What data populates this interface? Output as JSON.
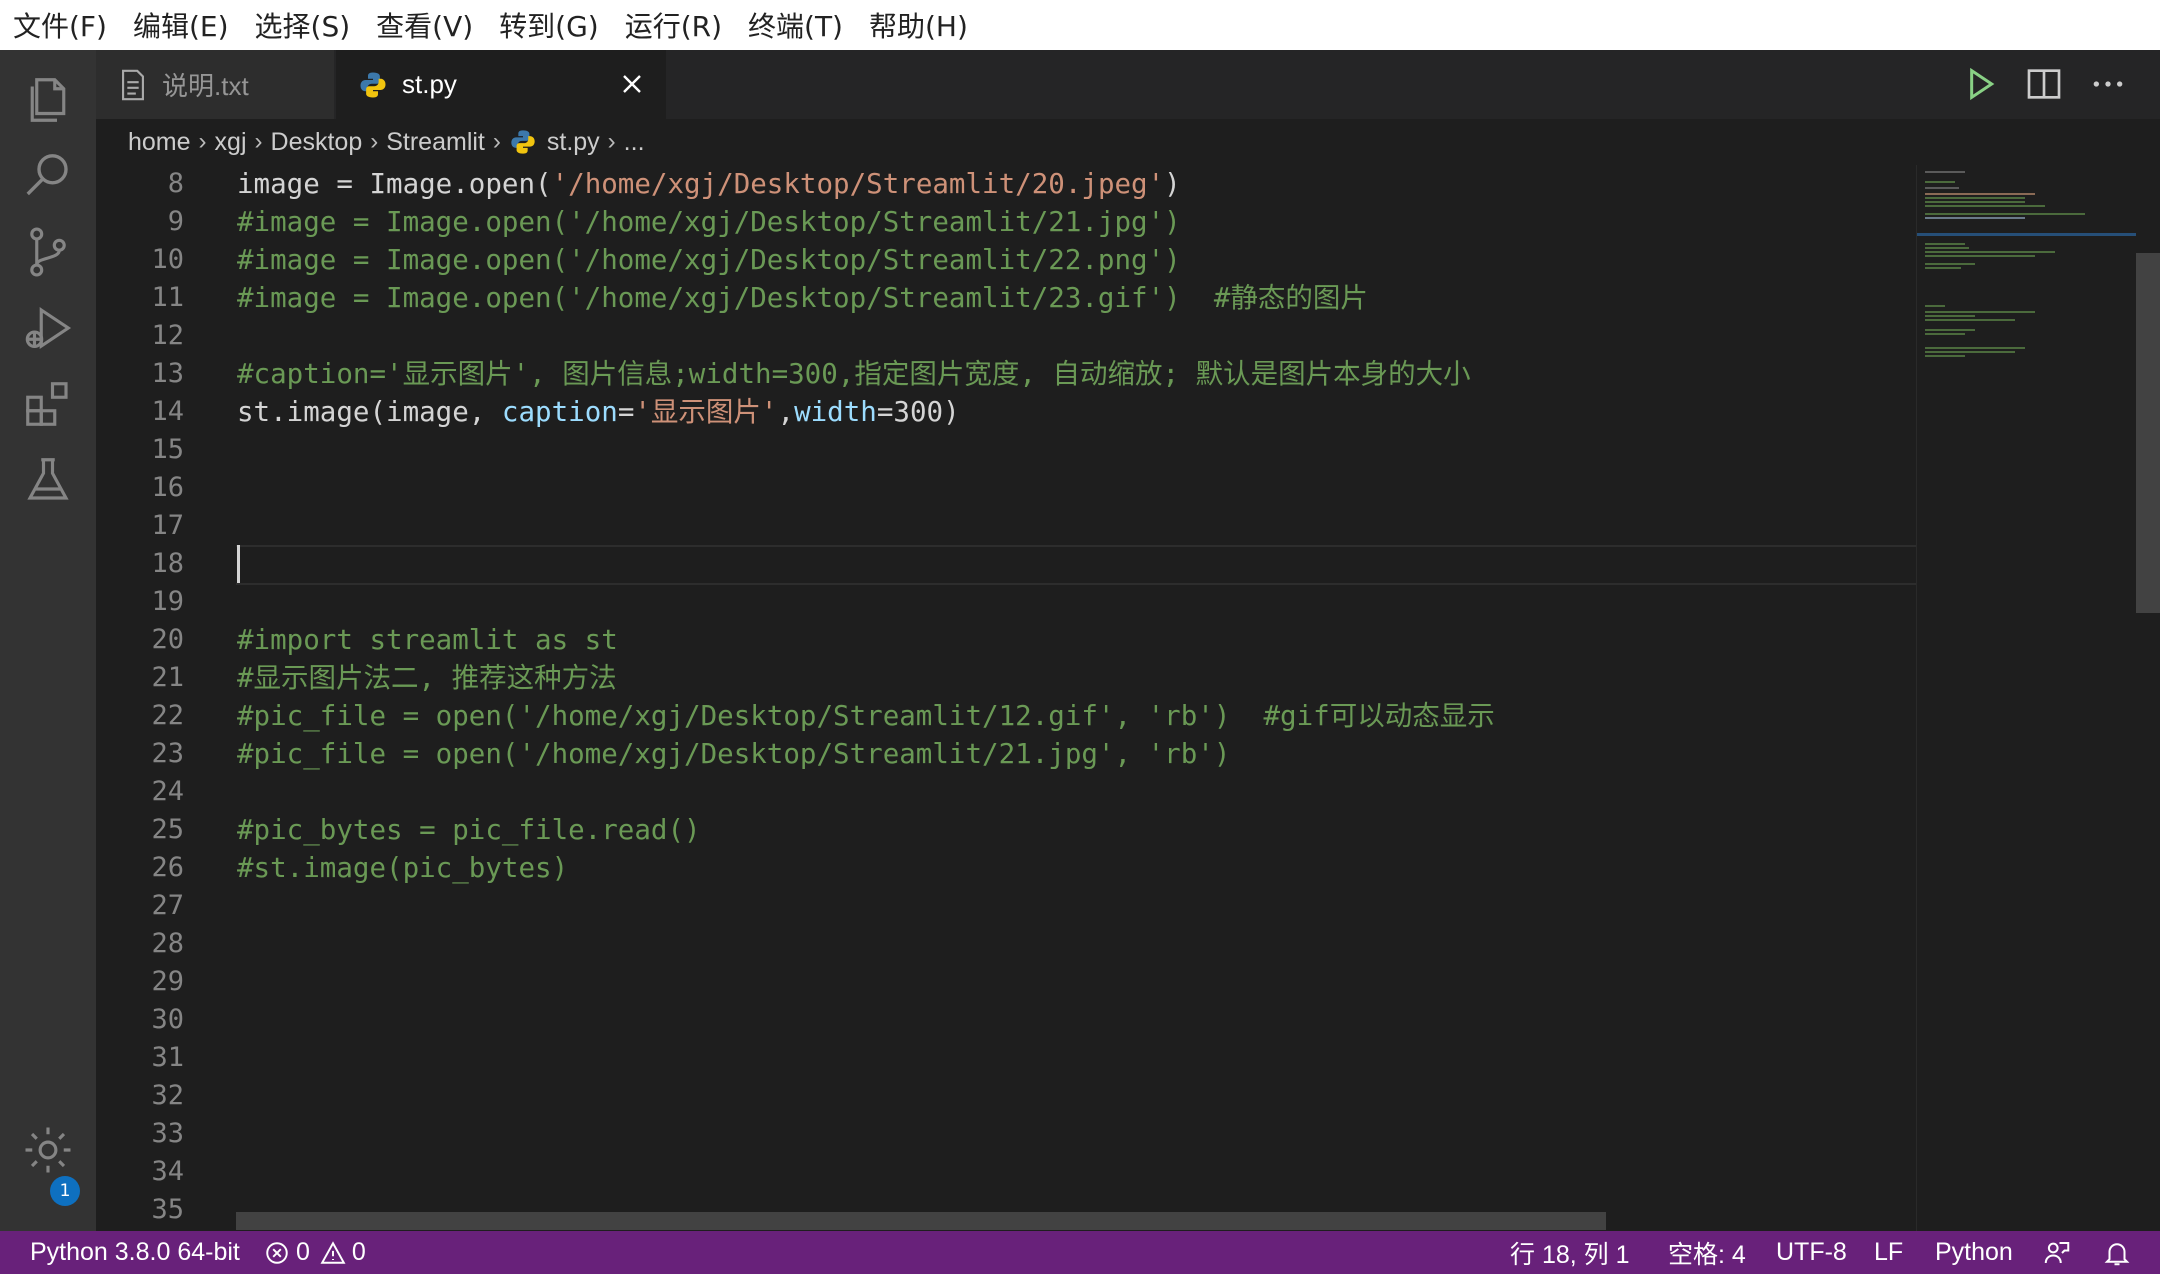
{
  "menubar": [
    "文件(F)",
    "编辑(E)",
    "选择(S)",
    "查看(V)",
    "转到(G)",
    "运行(R)",
    "终端(T)",
    "帮助(H)"
  ],
  "tabs": [
    {
      "label": "说明.txt",
      "icon": "text-file-icon",
      "active": false
    },
    {
      "label": "st.py",
      "icon": "python-icon",
      "active": true
    }
  ],
  "breadcrumb": [
    "home",
    "xgj",
    "Desktop",
    "Streamlit",
    "st.py",
    "..."
  ],
  "editor": {
    "cursor_line": 18,
    "lines": [
      {
        "n": "8",
        "tokens": [
          [
            "w",
            "image = Image.open("
          ],
          [
            "s",
            "'/home/xgj/Desktop/Streamlit/20.jpeg'"
          ],
          [
            "w",
            ")"
          ]
        ]
      },
      {
        "n": "9",
        "tokens": [
          [
            "c",
            "#image = Image.open('/home/xgj/Desktop/Streamlit/21.jpg')"
          ]
        ]
      },
      {
        "n": "10",
        "tokens": [
          [
            "c",
            "#image = Image.open('/home/xgj/Desktop/Streamlit/22.png')"
          ]
        ]
      },
      {
        "n": "11",
        "tokens": [
          [
            "c",
            "#image = Image.open('/home/xgj/Desktop/Streamlit/23.gif')  #静态的图片"
          ]
        ]
      },
      {
        "n": "12",
        "tokens": []
      },
      {
        "n": "13",
        "tokens": [
          [
            "c",
            "#caption='显示图片', 图片信息;width=300,指定图片宽度, 自动缩放; 默认是图片本身的大小"
          ]
        ]
      },
      {
        "n": "14",
        "tokens": [
          [
            "w",
            "st.image(image, "
          ],
          [
            "p",
            "caption"
          ],
          [
            "w",
            "="
          ],
          [
            "s",
            "'显示图片'"
          ],
          [
            "w",
            ","
          ],
          [
            "p",
            "width"
          ],
          [
            "w",
            "=300)"
          ]
        ]
      },
      {
        "n": "15",
        "tokens": []
      },
      {
        "n": "16",
        "tokens": []
      },
      {
        "n": "17",
        "tokens": []
      },
      {
        "n": "18",
        "tokens": []
      },
      {
        "n": "19",
        "tokens": []
      },
      {
        "n": "20",
        "tokens": [
          [
            "c",
            "#import streamlit as st"
          ]
        ]
      },
      {
        "n": "21",
        "tokens": [
          [
            "c",
            "#显示图片法二, 推荐这种方法"
          ]
        ]
      },
      {
        "n": "22",
        "tokens": [
          [
            "c",
            "#pic_file = open('/home/xgj/Desktop/Streamlit/12.gif', 'rb')  #gif可以动态显示"
          ]
        ]
      },
      {
        "n": "23",
        "tokens": [
          [
            "c",
            "#pic_file = open('/home/xgj/Desktop/Streamlit/21.jpg', 'rb')"
          ]
        ]
      },
      {
        "n": "24",
        "tokens": []
      },
      {
        "n": "25",
        "tokens": [
          [
            "c",
            "#pic_bytes = pic_file.read()"
          ]
        ]
      },
      {
        "n": "26",
        "tokens": [
          [
            "c",
            "#st.image(pic_bytes)"
          ]
        ]
      },
      {
        "n": "27",
        "tokens": []
      },
      {
        "n": "28",
        "tokens": []
      },
      {
        "n": "29",
        "tokens": []
      },
      {
        "n": "30",
        "tokens": []
      },
      {
        "n": "31",
        "tokens": []
      },
      {
        "n": "32",
        "tokens": []
      },
      {
        "n": "33",
        "tokens": []
      },
      {
        "n": "34",
        "tokens": []
      },
      {
        "n": "35",
        "tokens": []
      }
    ]
  },
  "activity_icons": [
    "explorer-icon",
    "search-icon",
    "source-control-icon",
    "run-debug-icon",
    "extensions-icon",
    "testing-icon",
    "settings-gear-icon"
  ],
  "settings_badge": "1",
  "statusbar": {
    "interpreter": "Python 3.8.0 64-bit",
    "errors": "0",
    "warnings": "0",
    "position": "行 18, 列 1",
    "spaces": "空格: 4",
    "encoding": "UTF-8",
    "eol": "LF",
    "language": "Python"
  },
  "colors": {
    "statusbar": "#68217a",
    "comment": "#6a9955",
    "string": "#ce9178",
    "param": "#9cdcfe",
    "editor_bg": "#1e1e1e"
  }
}
